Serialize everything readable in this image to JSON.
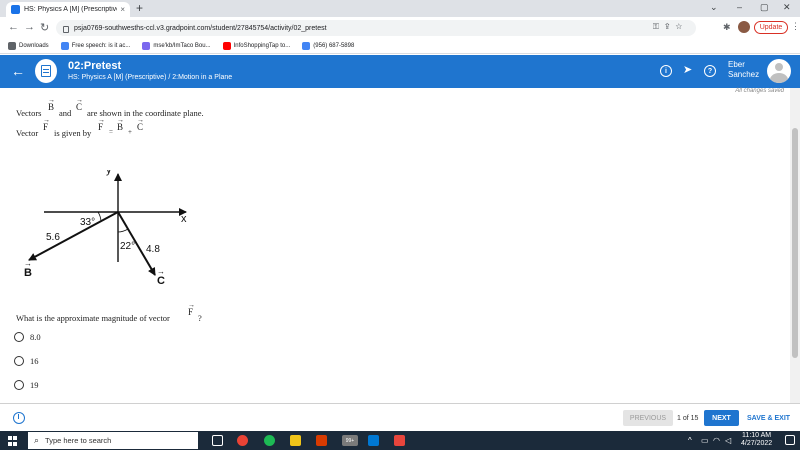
{
  "browser": {
    "tab_title": "HS: Physics A [M] (Prescriptive) -",
    "tab_close": "×",
    "new_tab": "+",
    "url": "psja0769-southwesths-ccl.v3.gradpoint.com/student/27845754/activity/02_pretest",
    "update_label": "Update",
    "bookmarks": [
      {
        "label": "Downloads",
        "color": "#5f6368"
      },
      {
        "label": "Free speech: is it ac...",
        "color": "#4285f4"
      },
      {
        "label": "mse'kb/ImTaco Bou...",
        "color": "#7b68ee"
      },
      {
        "label": "InfoShoppingTap to...",
        "color": "#ff0000"
      },
      {
        "label": "(956) 687-5898",
        "color": "#4285f4"
      }
    ]
  },
  "header": {
    "title": "02:Pretest",
    "subtitle": "HS: Physics A [M] (Prescriptive) / 2:Motion in a Plane",
    "user_first": "Eber",
    "user_last": "Sanchez",
    "info_glyph": "i",
    "help_glyph": "?"
  },
  "content": {
    "saved_status": "All changes saved",
    "line1_a": "Vectors",
    "line1_b": "and",
    "line1_c": "are shown in the coordinate plane.",
    "line2_a": "Vector",
    "line2_b": "is given by",
    "vec_B": "B",
    "vec_C": "C",
    "vec_F": "F",
    "eq_sign": "=",
    "plus_sign": "+",
    "question_a": "What is the approximate magnitude of vector",
    "question_b": "?",
    "choices": [
      "8.0",
      "16",
      "19"
    ]
  },
  "diagram": {
    "y_label": "y",
    "x_label": "x",
    "angle_B": "33°",
    "angle_C": "22°",
    "mag_B": "5.6",
    "mag_C": "4.8",
    "label_B": "B",
    "label_C": "C"
  },
  "footer": {
    "previous": "PREVIOUS",
    "page_count": "1 of 15",
    "next": "NEXT",
    "save_exit": "SAVE & EXIT"
  },
  "taskbar": {
    "search_placeholder": "Type here to search",
    "time": "11:10 AM",
    "date": "4/27/2022",
    "badge": "99+"
  }
}
